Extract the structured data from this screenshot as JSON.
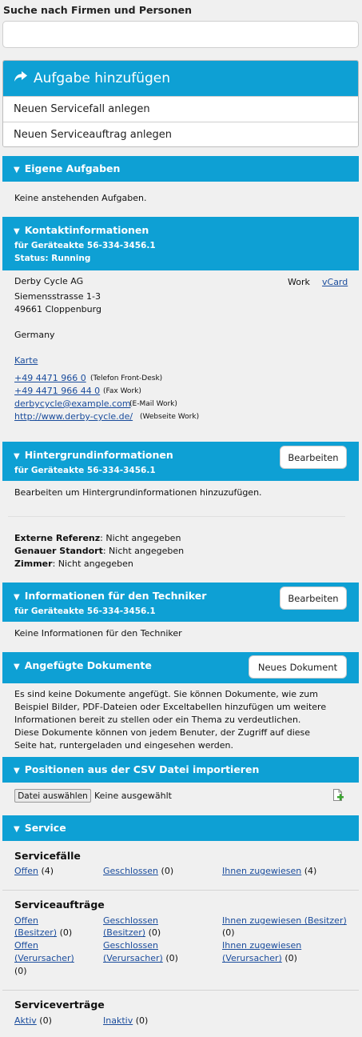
{
  "search": {
    "label": "Suche nach Firmen und Personen",
    "placeholder": ""
  },
  "add_task": {
    "title": "Aufgabe hinzufügen",
    "items": [
      "Neuen Servicefall anlegen",
      "Neuen Serviceauftrag anlegen"
    ]
  },
  "own_tasks": {
    "title": "Eigene Aufgaben",
    "body": "Keine anstehenden Aufgaben."
  },
  "contact": {
    "title": "Kontaktinformationen",
    "subtitle": "für Geräteakte 56-334-3456.1",
    "status": "Status: Running",
    "company": "Derby Cycle AG",
    "type": "Work",
    "vcard": "vCard",
    "street": "Siemensstrasse 1-3",
    "city": "49661 Cloppenburg",
    "country": "Germany",
    "map": "Karte",
    "phone": "+49 4471 966 0",
    "phone_label": "(Telefon Front-Desk)",
    "fax": "+49 4471 966 44 0",
    "fax_label": "(Fax Work)",
    "email": "derbycycle@example.com",
    "email_label": "(E-Mail Work)",
    "web": "http://www.derby-cycle.de/",
    "web_label": "(Webseite Work)"
  },
  "background": {
    "title": "Hintergrundinformationen",
    "subtitle": "für Geräteakte 56-334-3456.1",
    "edit": "Bearbeiten",
    "body": "Bearbeiten um Hintergrundinformationen hinzuzufügen.",
    "fields": [
      {
        "label": "Externe Referenz",
        "value": ": Nicht angegeben"
      },
      {
        "label": "Genauer Standort",
        "value": ": Nicht angegeben"
      },
      {
        "label": "Zimmer",
        "value": ": Nicht angegeben"
      }
    ]
  },
  "technician": {
    "title": "Informationen für den Techniker",
    "subtitle": "für Geräteakte 56-334-3456.1",
    "edit": "Bearbeiten",
    "body": "Keine Informationen für den Techniker"
  },
  "documents": {
    "title": "Angefügte Dokumente",
    "button": "Neues Dokument",
    "lines": [
      "Es sind keine Dokumente angefügt. Sie können Dokumente, wie zum",
      "Beispiel Bilder, PDF-Dateien oder Exceltabellen hinzufügen um weitere",
      "Informationen bereit zu stellen oder ein Thema zu verdeutlichen.",
      "Diese Dokumente können von jedem Benuter, der Zugriff auf diese",
      "Seite hat, runtergeladen und eingesehen werden."
    ]
  },
  "csv": {
    "title": "Positionen aus der CSV Datei importieren",
    "file_button": "Datei auswählen",
    "file_status": "Keine ausgewählt"
  },
  "service": {
    "title": "Service",
    "cases": {
      "heading": "Servicefälle",
      "open": "Offen",
      "open_count": "(4)",
      "closed": "Geschlossen",
      "closed_count": "(0)",
      "assigned": "Ihnen zugewiesen",
      "assigned_count": "(4)"
    },
    "orders": {
      "heading": "Serviceaufträge",
      "open_owner_1": "Offen",
      "open_owner_2": "(Besitzer)",
      "open_owner_count": "(0)",
      "closed_owner_1": "Geschlossen",
      "closed_owner_2": "(Besitzer)",
      "closed_owner_count": "(0)",
      "assigned_owner": "Ihnen zugewiesen (Besitzer)",
      "assigned_owner_count": "(0)",
      "open_causer_1": "Offen",
      "open_causer_2": "(Verursacher)",
      "open_causer_count": "(0)",
      "closed_causer_1": "Geschlossen",
      "closed_causer_2": "(Verursacher)",
      "closed_causer_count": "(0)",
      "assigned_causer_1": "Ihnen zugewiesen",
      "assigned_causer_2": "(Verursacher)",
      "assigned_causer_count": "(0)"
    },
    "contracts": {
      "heading": "Serviceverträge",
      "active": "Aktiv",
      "active_count": "(0)",
      "inactive": "Inaktiv",
      "inactive_count": "(0)"
    }
  }
}
